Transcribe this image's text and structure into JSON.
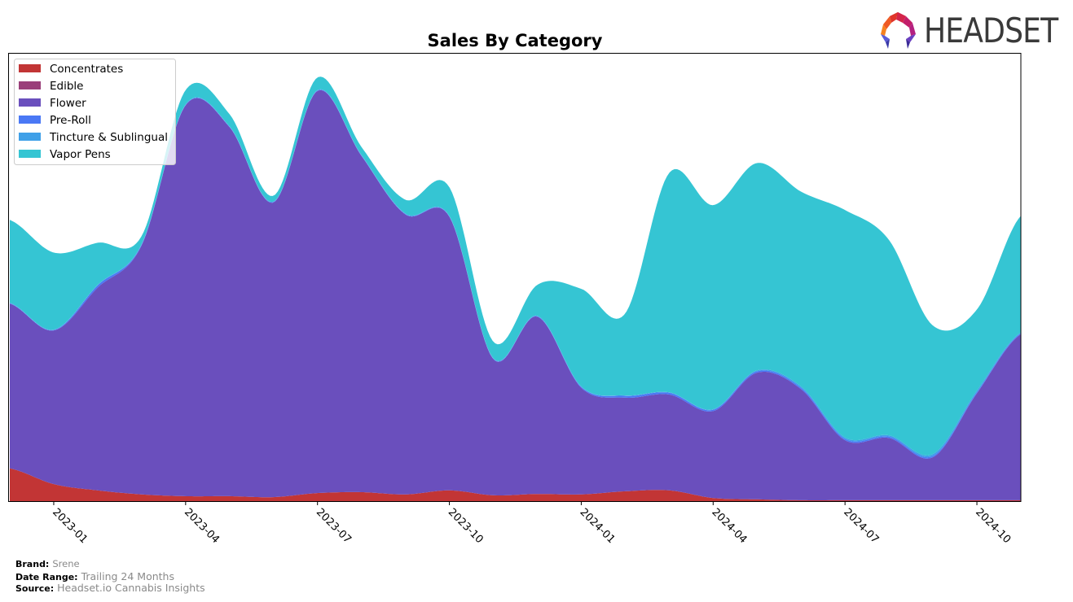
{
  "chart_data": {
    "type": "area",
    "stacked": true,
    "smoothed": true,
    "title": "Sales By Category",
    "xlabel": "",
    "ylabel": "",
    "x": [
      "2022-12",
      "2023-01",
      "2023-02",
      "2023-03",
      "2023-04",
      "2023-05",
      "2023-06",
      "2023-07",
      "2023-08",
      "2023-09",
      "2023-10",
      "2023-11",
      "2023-12",
      "2024-01",
      "2024-02",
      "2024-03",
      "2024-04",
      "2024-05",
      "2024-06",
      "2024-07",
      "2024-08",
      "2024-09",
      "2024-10",
      "2024-11"
    ],
    "x_ticks": [
      "2023-01",
      "2023-04",
      "2023-07",
      "2023-10",
      "2024-01",
      "2024-04",
      "2024-07",
      "2024-10"
    ],
    "ylim": [
      0,
      100
    ],
    "y_ticks_visible": false,
    "grid": false,
    "legend_position": "top-left",
    "series": [
      {
        "name": "Concentrates",
        "color": "#c23535",
        "values": [
          7.3,
          3.8,
          2.4,
          1.5,
          1.1,
          1.1,
          0.9,
          1.8,
          2.0,
          1.5,
          2.4,
          1.3,
          1.6,
          1.5,
          2.2,
          2.4,
          0.7,
          0.4,
          0.2,
          0.2,
          0.2,
          0.2,
          0.2,
          0.2
        ]
      },
      {
        "name": "Edible",
        "color": "#9a3f7a",
        "values": [
          0,
          0,
          0,
          0,
          0,
          0,
          0,
          0,
          0,
          0,
          0,
          0,
          0,
          0,
          0,
          0,
          0,
          0,
          0,
          0,
          0,
          0,
          0,
          0
        ]
      },
      {
        "name": "Flower",
        "color": "#6a4fbd",
        "values": [
          36.8,
          34.3,
          45.3,
          55.6,
          87.3,
          82.4,
          65.8,
          89.8,
          75.1,
          62.5,
          61.1,
          30.4,
          39.6,
          23.8,
          20.9,
          21.4,
          19.4,
          28.3,
          24.8,
          13.4,
          13.9,
          9.6,
          23.9,
          37.1
        ]
      },
      {
        "name": "Pre-Roll",
        "color": "#4a78f5",
        "values": [
          0.1,
          0.1,
          0.5,
          0.2,
          0.1,
          0.1,
          0.1,
          0.1,
          0.1,
          0.1,
          0.1,
          0.1,
          0.1,
          0.2,
          0.4,
          0.4,
          0.3,
          0.3,
          0.3,
          0.3,
          0.3,
          0.3,
          0.2,
          0.2
        ]
      },
      {
        "name": "Tincture & Sublingual",
        "color": "#3fa0e8",
        "values": [
          0.1,
          0.1,
          0.1,
          0.1,
          0.1,
          0.1,
          0.1,
          0.1,
          0.1,
          0.1,
          0.1,
          0.1,
          0.1,
          0.1,
          0.1,
          0.1,
          0.1,
          0.2,
          0.3,
          0.3,
          0.3,
          0.4,
          0.4,
          0.2
        ]
      },
      {
        "name": "Vapor Pens",
        "color": "#35c5d3",
        "values": [
          18.5,
          17.2,
          9.4,
          1.8,
          3.2,
          2.7,
          1.3,
          2.8,
          1.8,
          3.1,
          6.4,
          3.7,
          6.9,
          21.8,
          18.3,
          49.0,
          45.6,
          46.3,
          43.5,
          50.8,
          43.6,
          28.7,
          18.1,
          26.0
        ]
      }
    ]
  },
  "branding": {
    "logo_text": "HEADSET"
  },
  "footer": {
    "brand_label": "Brand:",
    "brand_value": "Srene",
    "date_range_label": "Date Range:",
    "date_range_value": "Trailing 24 Months",
    "source_label": "Source:",
    "source_value": "Headset.io Cannabis Insights"
  }
}
